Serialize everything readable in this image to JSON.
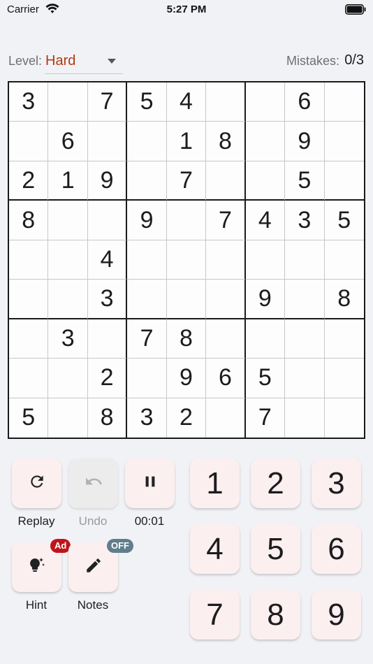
{
  "status_bar": {
    "carrier": "Carrier",
    "time": "5:27 PM"
  },
  "header": {
    "level_label": "Level:",
    "level_value": "Hard",
    "mistakes_label": "Mistakes:",
    "mistakes_value": "0/3"
  },
  "board": [
    [
      "3",
      "",
      "7",
      "5",
      "4",
      "",
      "",
      "6",
      ""
    ],
    [
      "",
      "6",
      "",
      "",
      "1",
      "8",
      "",
      "9",
      ""
    ],
    [
      "2",
      "1",
      "9",
      "",
      "7",
      "",
      "",
      "5",
      ""
    ],
    [
      "8",
      "",
      "",
      "9",
      "",
      "7",
      "4",
      "3",
      "5"
    ],
    [
      "",
      "",
      "4",
      "",
      "",
      "",
      "",
      "",
      ""
    ],
    [
      "",
      "",
      "3",
      "",
      "",
      "",
      "9",
      "",
      "8"
    ],
    [
      "",
      "3",
      "",
      "7",
      "8",
      "",
      "",
      "",
      ""
    ],
    [
      "",
      "",
      "2",
      "",
      "9",
      "6",
      "5",
      "",
      ""
    ],
    [
      "5",
      "",
      "8",
      "3",
      "2",
      "",
      "7",
      "",
      ""
    ]
  ],
  "controls": {
    "replay_label": "Replay",
    "undo_label": "Undo",
    "timer": "00:01",
    "hint_label": "Hint",
    "hint_badge": "Ad",
    "notes_label": "Notes",
    "notes_badge": "OFF"
  },
  "numpad": [
    "1",
    "2",
    "3",
    "4",
    "5",
    "6",
    "7",
    "8",
    "9"
  ],
  "colors": {
    "level_accent": "#b3390f",
    "button_bg": "#fbeff0",
    "ad_badge": "#c0141a",
    "notes_badge": "#607d8b"
  }
}
